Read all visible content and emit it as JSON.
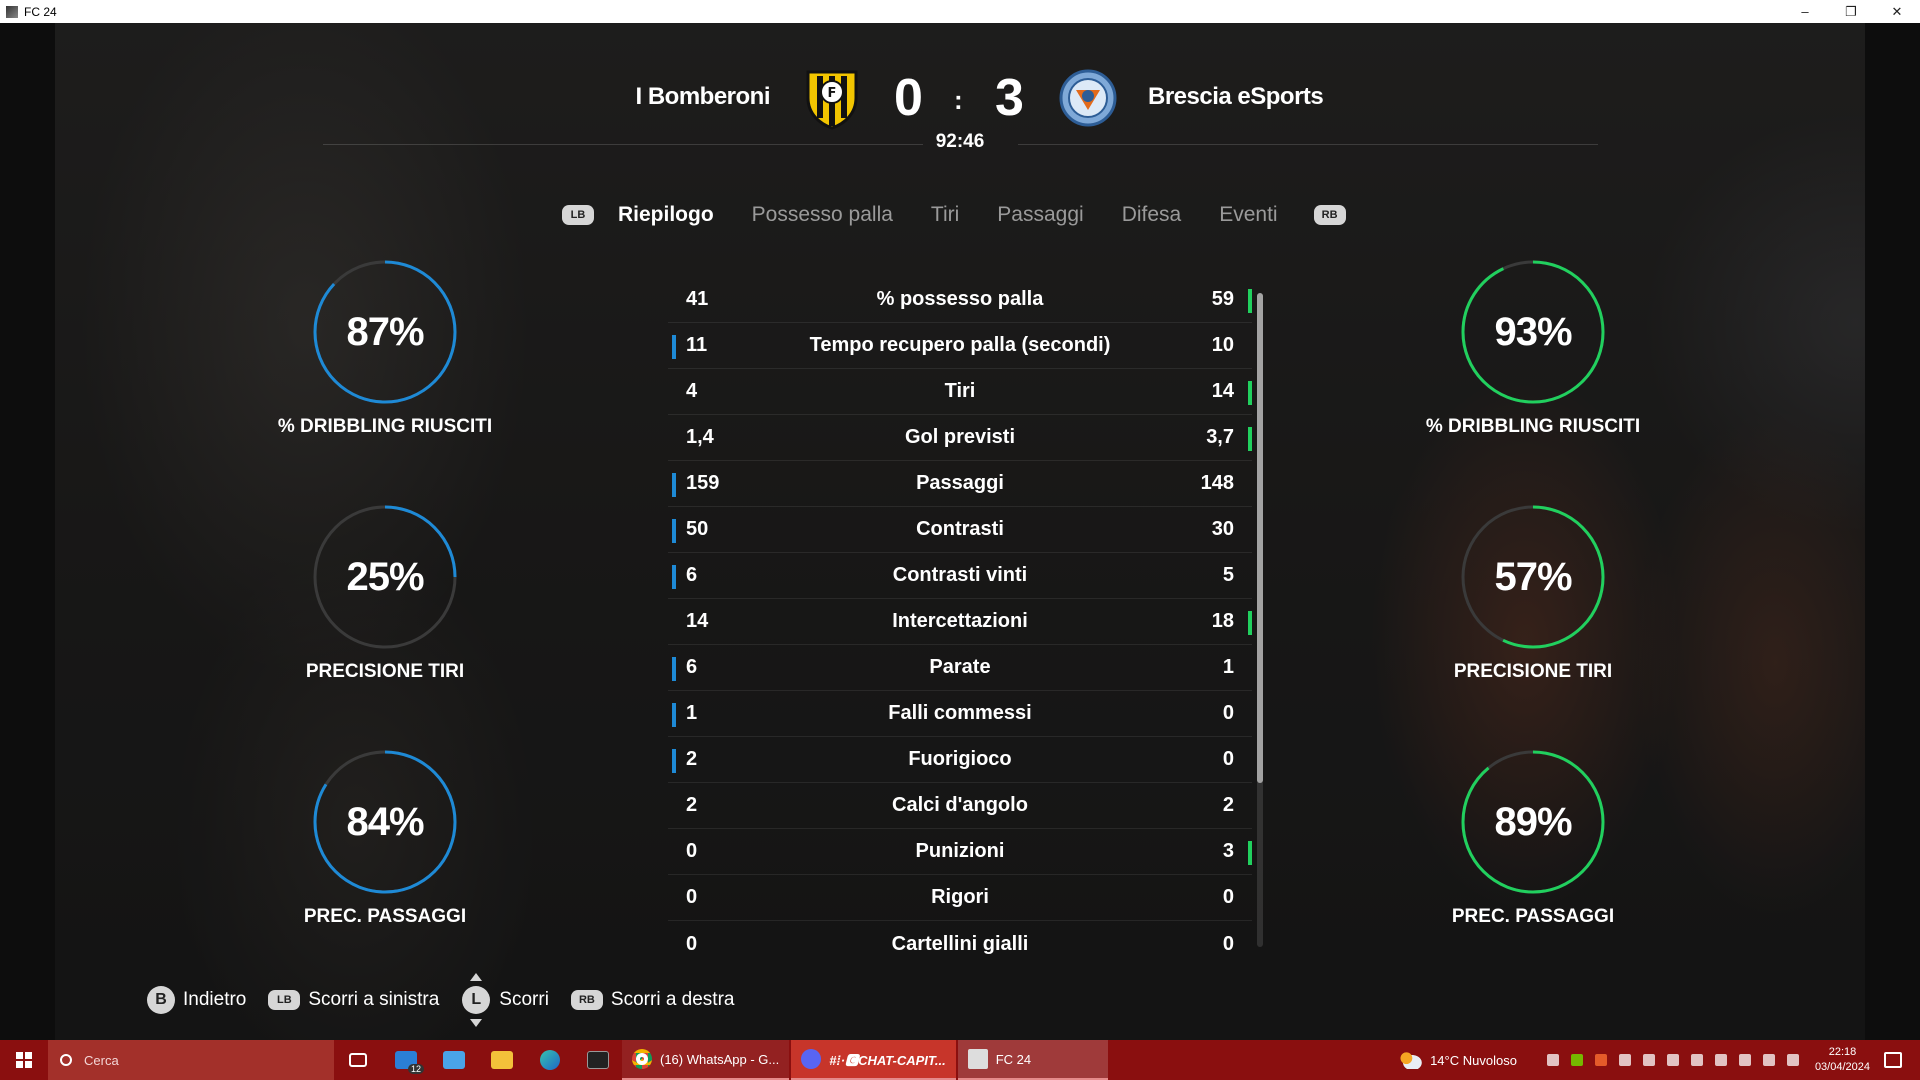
{
  "window": {
    "title": "FC 24",
    "minimize": "–",
    "restore": "❐",
    "close": "✕"
  },
  "match": {
    "home_team": "I Bomberoni",
    "away_team": "Brescia eSports",
    "home_score": "0",
    "away_score": "3",
    "separator": ":",
    "time": "92:46"
  },
  "tabs": {
    "lb": "LB",
    "rb": "RB",
    "items": [
      "Riepilogo",
      "Possesso palla",
      "Tiri",
      "Passaggi",
      "Difesa",
      "Eventi"
    ],
    "active": "Riepilogo"
  },
  "home_rings": [
    {
      "value": "87%",
      "fraction": 0.87,
      "label": "% DRIBBLING RIUSCITI"
    },
    {
      "value": "25%",
      "fraction": 0.25,
      "label": "PRECISIONE TIRI"
    },
    {
      "value": "84%",
      "fraction": 0.84,
      "label": "PREC. PASSAGGI"
    }
  ],
  "away_rings": [
    {
      "value": "93%",
      "fraction": 0.93,
      "label": "% DRIBBLING RIUSCITI"
    },
    {
      "value": "57%",
      "fraction": 0.57,
      "label": "PRECISIONE TIRI"
    },
    {
      "value": "89%",
      "fraction": 0.89,
      "label": "PREC. PASSAGGI"
    }
  ],
  "colors": {
    "home": "#1e8ad6",
    "away": "#21d05e",
    "ring_track": "#3a3a3a"
  },
  "stats": [
    {
      "name": "% possesso palla",
      "home": "41",
      "away": "59",
      "leader": "away"
    },
    {
      "name": "Tempo recupero palla (secondi)",
      "home": "11",
      "away": "10",
      "leader": "home"
    },
    {
      "name": "Tiri",
      "home": "4",
      "away": "14",
      "leader": "away"
    },
    {
      "name": "Gol previsti",
      "home": "1,4",
      "away": "3,7",
      "leader": "away"
    },
    {
      "name": "Passaggi",
      "home": "159",
      "away": "148",
      "leader": "home"
    },
    {
      "name": "Contrasti",
      "home": "50",
      "away": "30",
      "leader": "home"
    },
    {
      "name": "Contrasti vinti",
      "home": "6",
      "away": "5",
      "leader": "home"
    },
    {
      "name": "Intercettazioni",
      "home": "14",
      "away": "18",
      "leader": "away"
    },
    {
      "name": "Parate",
      "home": "6",
      "away": "1",
      "leader": "home"
    },
    {
      "name": "Falli commessi",
      "home": "1",
      "away": "0",
      "leader": "home"
    },
    {
      "name": "Fuorigioco",
      "home": "2",
      "away": "0",
      "leader": "home"
    },
    {
      "name": "Calci d'angolo",
      "home": "2",
      "away": "2",
      "leader": "none"
    },
    {
      "name": "Punizioni",
      "home": "0",
      "away": "3",
      "leader": "away"
    },
    {
      "name": "Rigori",
      "home": "0",
      "away": "0",
      "leader": "none"
    },
    {
      "name": "Cartellini gialli",
      "home": "0",
      "away": "0",
      "leader": "none"
    }
  ],
  "hints": {
    "back_btn": "B",
    "back": "Indietro",
    "lb_btn": "LB",
    "scroll_left": "Scorri a sinistra",
    "l_btn": "L",
    "scroll": "Scorri",
    "rb_btn": "RB",
    "scroll_right": "Scorri a destra"
  },
  "taskbar": {
    "search_placeholder": "Cerca",
    "mail_badge": "12",
    "tasks": [
      {
        "label": "(16) WhatsApp - G...",
        "icon": "chrome-icon"
      },
      {
        "label": "#⁞·🅲CHAT-CAPIT...",
        "icon": "discord-icon"
      },
      {
        "label": "FC 24",
        "icon": "fc24-icon"
      }
    ],
    "weather": "14°C  Nuvoloso",
    "time": "22:18",
    "date": "03/04/2024"
  }
}
